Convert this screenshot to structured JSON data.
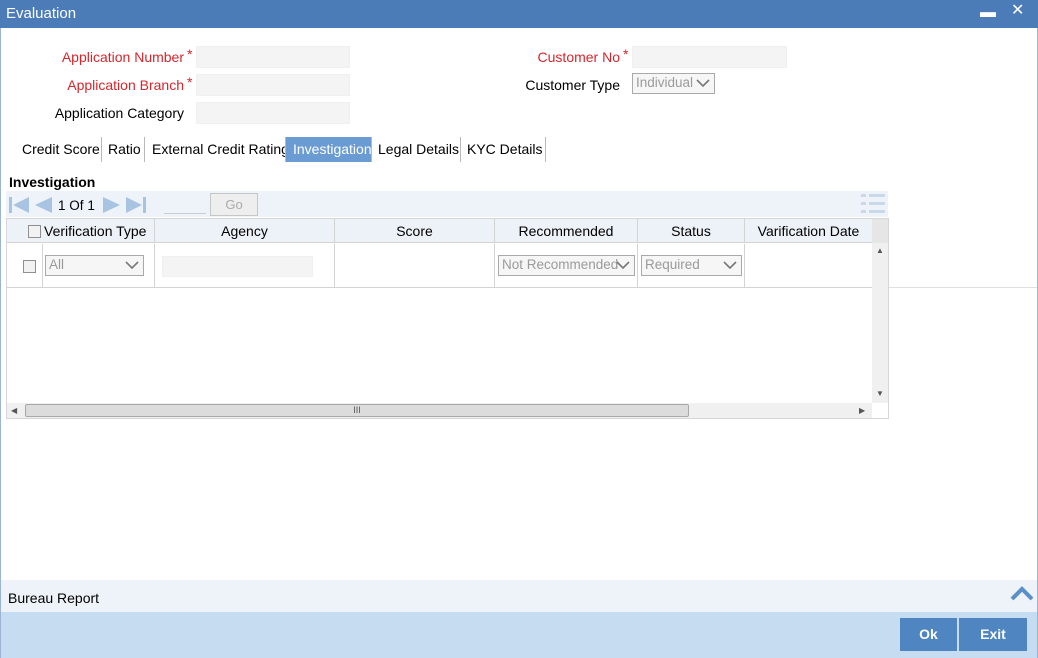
{
  "window": {
    "title": "Evaluation",
    "minimize": "▬",
    "close": "✕"
  },
  "form": {
    "application_number_label": "Application Number",
    "application_branch_label": "Application Branch",
    "application_category_label": "Application Category",
    "customer_no_label": "Customer No",
    "customer_type_label": "Customer Type",
    "customer_type_value": "Individual",
    "required_mark": "*"
  },
  "tabs": [
    {
      "label": "Credit Score"
    },
    {
      "label": "Ratio"
    },
    {
      "label": "External Credit Rating"
    },
    {
      "label": "Investigation",
      "active": true
    },
    {
      "label": "Legal Details"
    },
    {
      "label": "KYC Details"
    }
  ],
  "investigation": {
    "title": "Investigation",
    "pager": {
      "current": "1",
      "of_label": "Of",
      "total": "1",
      "go_label": "Go"
    },
    "columns": [
      "Verification Type",
      "Agency",
      "Score",
      "Recommended",
      "Status",
      "Varification Date"
    ],
    "row": {
      "verification_type": "All",
      "recommended": "Not Recommended",
      "status": "Required"
    },
    "hscroll_grip": "III"
  },
  "bureau_report": {
    "label": "Bureau Report"
  },
  "footer": {
    "ok_label": "Ok",
    "exit_label": "Exit"
  },
  "colors": {
    "titlebar": "#4b7cb8",
    "active_tab": "#6a9bd2",
    "required": "#d6262c",
    "button": "#4f86c1",
    "footer": "#c6dcf1"
  }
}
